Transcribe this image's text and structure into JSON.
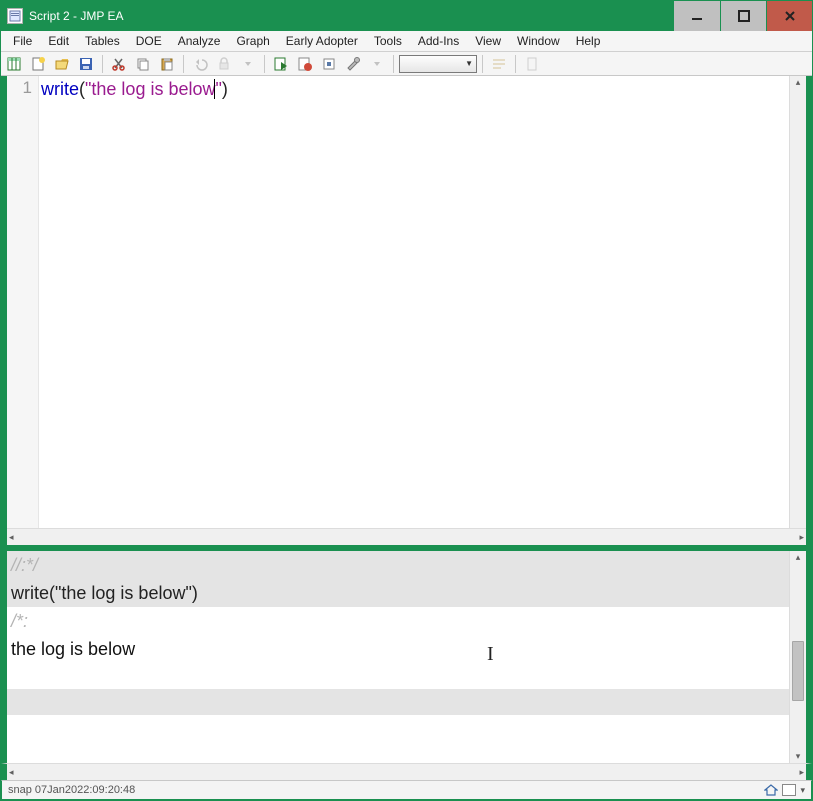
{
  "window": {
    "title": "Script 2 - JMP EA"
  },
  "menu": {
    "items": [
      "File",
      "Edit",
      "Tables",
      "DOE",
      "Analyze",
      "Graph",
      "Early Adopter",
      "Tools",
      "Add-Ins",
      "View",
      "Window",
      "Help"
    ]
  },
  "editor": {
    "line_number": "1",
    "code_keyword": "write",
    "code_open": "(",
    "code_string_q1": "\"",
    "code_string_body": "the log is below",
    "code_string_q2": "\"",
    "code_close": ")"
  },
  "log": {
    "line1": "//:*/",
    "line2": "write(\"the log is below\")",
    "line3": "/*:",
    "line4": "the log is below"
  },
  "status": {
    "left": "snap 07Jan2022:09:20:48"
  }
}
